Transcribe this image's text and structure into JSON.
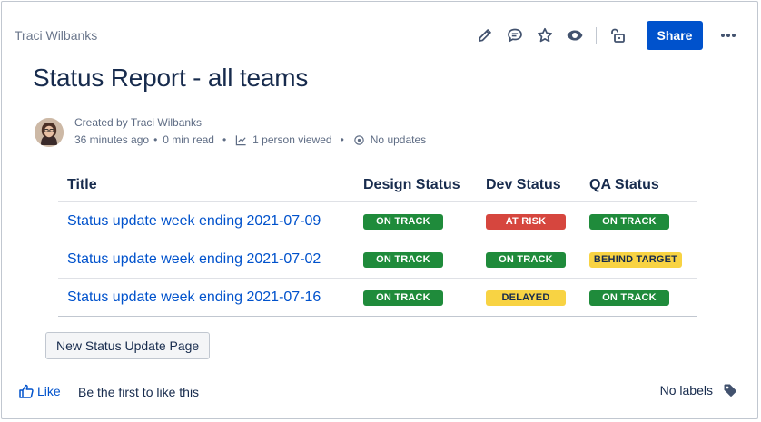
{
  "header": {
    "author": "Traci Wilbanks",
    "share_label": "Share",
    "icons": [
      "pencil-icon",
      "comment-icon",
      "star-icon",
      "eye-icon",
      "unlock-icon",
      "more-icon"
    ]
  },
  "page": {
    "title": "Status Report - all teams"
  },
  "byline": {
    "created_by": "Created by Traci Wilbanks",
    "time": "36 minutes ago",
    "read_time": "0 min read",
    "viewed": "1 person viewed",
    "updates": "No updates"
  },
  "table": {
    "headers": [
      "Title",
      "Design Status",
      "Dev Status",
      "QA Status"
    ],
    "rows": [
      {
        "title": "Status update week ending 2021-07-09",
        "design": "ON TRACK",
        "dev": "AT RISK",
        "qa": "ON TRACK"
      },
      {
        "title": "Status update week ending 2021-07-02",
        "design": "ON TRACK",
        "dev": "ON TRACK",
        "qa": "BEHIND TARGET"
      },
      {
        "title": "Status update week ending 2021-07-16",
        "design": "ON TRACK",
        "dev": "DELAYED",
        "qa": "ON TRACK"
      }
    ]
  },
  "actions": {
    "new_page_label": "New Status Update Page"
  },
  "footer": {
    "like_label": "Like",
    "like_hint": "Be the first to like this",
    "labels_text": "No labels"
  },
  "colors": {
    "brand": "#0052cc",
    "on_track": "#1f8b3b",
    "at_risk": "#d6463e",
    "delayed": "#f8d343"
  }
}
